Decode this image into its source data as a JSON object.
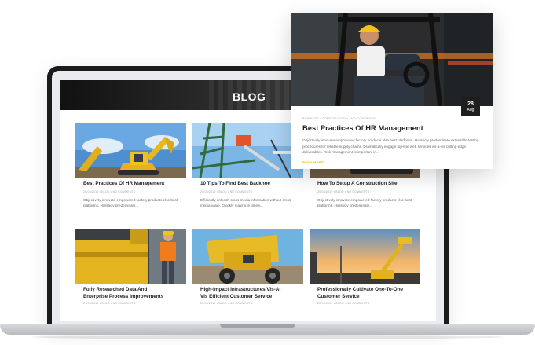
{
  "banner": {
    "title": "BLOG"
  },
  "cards": [
    {
      "title": "Best Practices Of HR Management",
      "meta": "20/03/2019 • BLOG • NO COMMENTS",
      "excerpt": "Objectively innovate empowered factory products else best platforms. Holisticly predominate..."
    },
    {
      "title": "10 Tips To Find Best Backhoe",
      "meta": "20/03/2019 • BLOG • NO COMMENTS",
      "excerpt": "Efficiently unleash cross-media information without cross-media value. Quickly maximize timely..."
    },
    {
      "title": "How To Setup A Construction Site",
      "meta": "20/03/2019 • BLOG • NO COMMENTS",
      "excerpt": "Objectively innovate empowered factory products else best platforms. Holisticly predominate..."
    },
    {
      "title_line1": "Fully Researched Data And",
      "title_line2": "Enterprise Process Improvements",
      "meta": "20/03/2019 • BLOG • NO COMMENTS"
    },
    {
      "title_line1": "High-Impact Infrastructures Vis-A-",
      "title_line2": "Vis Efficient Customer Service",
      "meta": "20/03/2019 • BLOG • NO COMMENTS"
    },
    {
      "title_line1": "Professionally Cultivate One-To-One",
      "title_line2": "Customer Service",
      "meta": "20/03/2019 • BLOG • NO COMMENTS"
    }
  ],
  "popup": {
    "date_day": "28",
    "date_month": "Aug",
    "meta": "BUSINESS • CONSTRUCTION • NO COMMENTS",
    "title": "Best Practices Of HR Management",
    "excerpt": "Objectively innovate empowered factory products else best platforms. Holisticly predominate extensible testing procedures for reliable supply chains. Dramatically engage top-line web services vis-a-vis cutting-edge deliverables. Risk management is important in...",
    "read_more": "READ MORE →"
  }
}
